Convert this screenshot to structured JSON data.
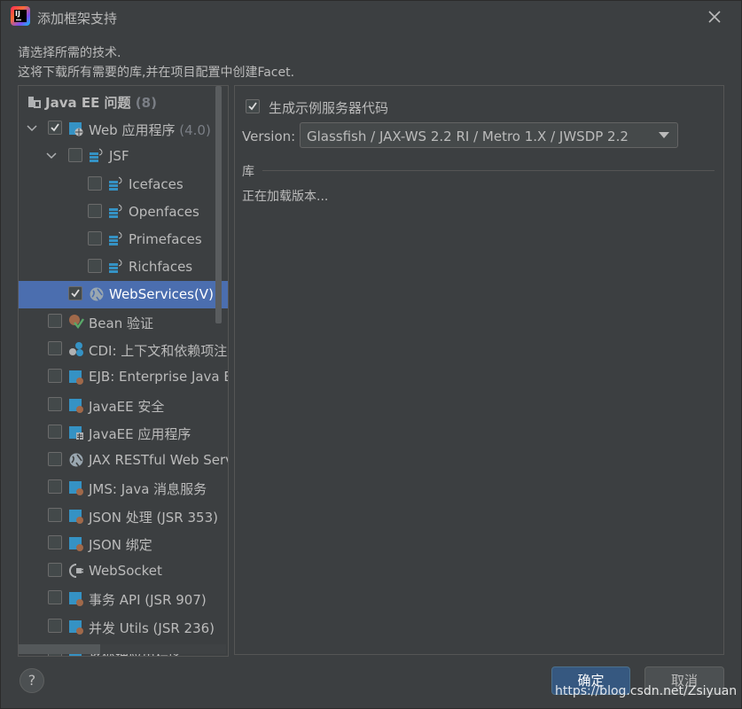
{
  "dialog": {
    "title": "添加框架支持",
    "description_line1": "请选择所需的技术.",
    "description_line2": "这将下载所有需要的库,并在项目配置中创建Facet."
  },
  "tree": {
    "root": {
      "label": "Java EE 问题",
      "count": "(8)"
    },
    "web_app": {
      "label": "Web 应用程序",
      "version": "(4.0)",
      "checked": true
    },
    "jsf": {
      "label": "JSF",
      "checked": false
    },
    "icefaces": {
      "label": "Icefaces",
      "checked": false
    },
    "openfaces": {
      "label": "Openfaces",
      "checked": false
    },
    "primefaces": {
      "label": "Primefaces",
      "checked": false
    },
    "richfaces": {
      "label": "Richfaces",
      "checked": false
    },
    "webservices": {
      "label": "WebServices(V)",
      "checked": true,
      "selected": true
    },
    "bean_validation": {
      "label": "Bean 验证"
    },
    "cdi": {
      "label": "CDI: 上下文和依赖项注入"
    },
    "ejb": {
      "label": "EJB: Enterprise Java Beans"
    },
    "javaee_security": {
      "label": "JavaEE 安全"
    },
    "javaee_app": {
      "label": "JavaEE 应用程序"
    },
    "jax_rest": {
      "label": "JAX RESTful Web Services"
    },
    "jms": {
      "label": "JMS: Java 消息服务"
    },
    "json_processing": {
      "label": "JSON 处理 (JSR 353)"
    },
    "json_binding": {
      "label": "JSON 绑定"
    },
    "websocket": {
      "label": "WebSocket"
    },
    "transaction": {
      "label": "事务 API (JSR 907)"
    },
    "concurrency": {
      "label": "并发 Utils (JSR 236)"
    },
    "batch": {
      "label": "批处理应用程序"
    }
  },
  "settings": {
    "generate_sample_label": "生成示例服务器代码",
    "generate_sample_checked": true,
    "version_label": "Version:",
    "version_value": "Glassfish / JAX-WS 2.2 RI / Metro 1.X / JWSDP 2.2",
    "library_title": "库",
    "loading_text": "正在加载版本..."
  },
  "buttons": {
    "help": "?",
    "ok": "确定",
    "cancel": "取消"
  },
  "watermark": "https://blog.csdn.net/Zsiyuan",
  "colors": {
    "background": "#3c3f41",
    "selection": "#4b6eaf",
    "primary_button": "#365880",
    "text": "#bbbbbb"
  }
}
